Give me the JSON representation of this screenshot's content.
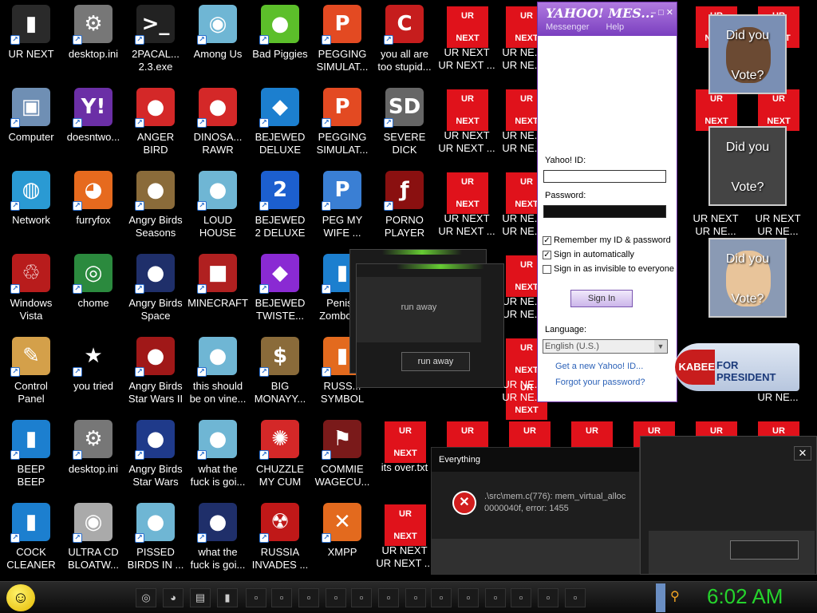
{
  "desktop_icons": [
    {
      "label": "UR NEXT",
      "icon": "iphone-icon",
      "glyph": "▮",
      "bg": "#2a2a2a"
    },
    {
      "label": "desktop.ini",
      "icon": "config-file-icon",
      "glyph": "⚙",
      "bg": "#777"
    },
    {
      "label": "2PACAL...\n2.3.exe",
      "icon": "console-icon",
      "glyph": ">_",
      "bg": "#222"
    },
    {
      "label": "Among Us",
      "icon": "among-us-icon",
      "glyph": "◉",
      "bg": "#6fb6d4"
    },
    {
      "label": "Bad Piggies",
      "icon": "bad-piggies-icon",
      "glyph": "●",
      "bg": "#5cbf2a"
    },
    {
      "label": "PEGGING\nSIMULAT...",
      "icon": "peggle-icon",
      "glyph": "P",
      "bg": "#e34a22"
    },
    {
      "label": "you all are\ntoo stupid...",
      "icon": "dev-cpp-icon",
      "glyph": "C",
      "bg": "#c61d1d"
    },
    {
      "label": "Computer",
      "icon": "computer-icon",
      "glyph": "▣",
      "bg": "#6f8fb4"
    },
    {
      "label": "doesntwo...",
      "icon": "yahoo-messenger-icon",
      "glyph": "Y!",
      "bg": "#6b2fa6"
    },
    {
      "label": "ANGER\nBIRD",
      "icon": "angry-birds-icon",
      "glyph": "●",
      "bg": "#d42828"
    },
    {
      "label": "DINOSA...\nRAWR",
      "icon": "angry-birds-icon",
      "glyph": "●",
      "bg": "#d42828"
    },
    {
      "label": "BEJEWED\nDELUXE",
      "icon": "bejeweled-icon",
      "glyph": "◆",
      "bg": "#1c7fcf"
    },
    {
      "label": "PEGGING\nSIMULAT...",
      "icon": "peggle-icon",
      "glyph": "P",
      "bg": "#e34a22"
    },
    {
      "label": "SEVERE\nDICK",
      "icon": "sd-tool-icon",
      "glyph": "SD",
      "bg": "#666"
    },
    {
      "label": "Network",
      "icon": "network-icon",
      "glyph": "◍",
      "bg": "#2a9ad3"
    },
    {
      "label": "furryfox",
      "icon": "firefox-icon",
      "glyph": "◕",
      "bg": "#e66a1e"
    },
    {
      "label": "Angry Birds\nSeasons",
      "icon": "angry-birds-seasons-icon",
      "glyph": "●",
      "bg": "#8a6b3a"
    },
    {
      "label": "LOUD\nHOUSE",
      "icon": "angry-birds-icon",
      "glyph": "●",
      "bg": "#6fb6d4"
    },
    {
      "label": "BEJEWED\n2 DELUXE",
      "icon": "bejeweled-icon",
      "glyph": "2",
      "bg": "#1c5fcf"
    },
    {
      "label": "PEG MY\nWIFE ...",
      "icon": "peggle-icon",
      "glyph": "P",
      "bg": "#3a7fd4"
    },
    {
      "label": "PORNO\nPLAYER",
      "icon": "flash-player-icon",
      "glyph": "ƒ",
      "bg": "#8a1010"
    },
    {
      "label": "Windows\nVista",
      "icon": "recycle-bin-icon",
      "glyph": "♲",
      "bg": "#b81c1c"
    },
    {
      "label": "chome",
      "icon": "chrome-icon",
      "glyph": "◎",
      "bg": "#2b8a3e"
    },
    {
      "label": "Angry Birds\nSpace",
      "icon": "angry-birds-space-icon",
      "glyph": "●",
      "bg": "#1f2f6a"
    },
    {
      "label": "MINECRAFT",
      "icon": "minecraft-icon",
      "glyph": "■",
      "bg": "#b02020"
    },
    {
      "label": "BEJEWED\nTWISTE...",
      "icon": "bejeweled-twist-icon",
      "glyph": "◆",
      "bg": "#8a2ad3"
    },
    {
      "label": "Penise\nZomboc...",
      "icon": "pvz-icon",
      "glyph": "▮",
      "bg": "#1c7fcf"
    },
    {
      "label": "Control\nPanel",
      "icon": "control-panel-icon",
      "glyph": "✎",
      "bg": "#d4a04a"
    },
    {
      "label": "you tried",
      "icon": "star-icon",
      "glyph": "★",
      "bg": "transparent"
    },
    {
      "label": "Angry Birds\nStar Wars II",
      "icon": "angry-birds-star-wars-icon",
      "glyph": "●",
      "bg": "#a01818"
    },
    {
      "label": "this should\nbe on vine...",
      "icon": "angry-birds-icon",
      "glyph": "●",
      "bg": "#6fb6d4"
    },
    {
      "label": "BIG\nMONAYY...",
      "icon": "money-bag-icon",
      "glyph": "$",
      "bg": "#8a6b3a"
    },
    {
      "label": "RUSS...\nSYMBOL",
      "icon": "document-icon",
      "glyph": "▮",
      "bg": "#e36a1e"
    },
    {
      "label": "BEEP\nBEEP",
      "icon": "phone-icon",
      "glyph": "▮",
      "bg": "#1c7fcf"
    },
    {
      "label": "desktop.ini",
      "icon": "config-file-icon",
      "glyph": "⚙",
      "bg": "#777"
    },
    {
      "label": "Angry Birds\nStar Wars",
      "icon": "angry-birds-star-wars-icon",
      "glyph": "●",
      "bg": "#1f3a8a"
    },
    {
      "label": "what the\nfuck is goi...",
      "icon": "angry-birds-icon",
      "glyph": "●",
      "bg": "#6fb6d4"
    },
    {
      "label": "CHUZZLE\nMY CUM",
      "icon": "chuzzle-icon",
      "glyph": "✺",
      "bg": "#d42828"
    },
    {
      "label": "COMMIE\nWAGECU...",
      "icon": "papers-please-icon",
      "glyph": "⚑",
      "bg": "#7a1a1a"
    },
    {
      "label": "COCK\nCLEANER",
      "icon": "ccleaner-icon",
      "glyph": "▮",
      "bg": "#1c7fcf"
    },
    {
      "label": "ULTRA CD\nBLOATW...",
      "icon": "cd-icon",
      "glyph": "◉",
      "bg": "#aaa"
    },
    {
      "label": "PISSED\nBIRDS IN ...",
      "icon": "angry-birds-icon",
      "glyph": "●",
      "bg": "#6fb6d4"
    },
    {
      "label": "what the\nfuck is goi...",
      "icon": "angry-birds-space-icon",
      "glyph": "●",
      "bg": "#1f2f6a"
    },
    {
      "label": "RUSSIA\nINVADES ...",
      "icon": "radiation-icon",
      "glyph": "☢",
      "bg": "#c01818"
    },
    {
      "label": "XMPP",
      "icon": "xampp-icon",
      "glyph": "✕",
      "bg": "#e36a1e"
    }
  ],
  "ur_labels": {
    "c7r1": "UR NEXT\nUR NEXT ...",
    "c8r1": "UR NE...\nUR NE...",
    "c7r2": "UR NEXT\nUR NEXT ...",
    "c8r2": "UR NE...\nUR NE...",
    "c7r3": "UR NEXT\nUR NEXT ...",
    "c8r3": "UR NE...\nUR NE...",
    "c8r4": "UR NE...\nUR NE...",
    "c8r5": "UR NE...\nUR NE...",
    "c11r3": "UR NEXT\nUR NE...",
    "c12r3": "UR NEXT\nUR NE...",
    "c12r5": "UR NE...",
    "c6r6": "its over.txt",
    "c6r7": "UR NEXT\nUR NEXT ...",
    "tile_top": "UR",
    "tile_bottom": "NEXT"
  },
  "yahoo": {
    "title": "YAHOO! MES...",
    "menu_messenger": "Messenger",
    "menu_help": "Help",
    "id_label": "Yahoo! ID:",
    "password_label": "Password:",
    "remember": "Remember my ID & password",
    "auto": "Sign in automatically",
    "invisible": "Sign in as invisible to everyone",
    "sign_in": "Sign In",
    "language_label": "Language:",
    "language_value": "English (U.S.)",
    "get_new_id": "Get a new Yahoo! ID...",
    "forgot": "Forgot your password?"
  },
  "runaway": {
    "back_title": "run away",
    "body_text": "run away",
    "button": "run away"
  },
  "everything_dialog": {
    "title": "Everything",
    "message": ".\\src\\mem.c(776): mem_virtual_alloc\n0000040f, error: 1455"
  },
  "vote": {
    "line1": "Did you",
    "line2": "Vote?"
  },
  "banner": {
    "left": "KABEE",
    "right": "FOR PRESIDENT"
  },
  "taskbar": {
    "clock": "6:02 AM"
  },
  "colors": {
    "ur_red": "#e0121b",
    "clock_green": "#25d32c",
    "yahoo_purple": "#7a3fbf"
  }
}
